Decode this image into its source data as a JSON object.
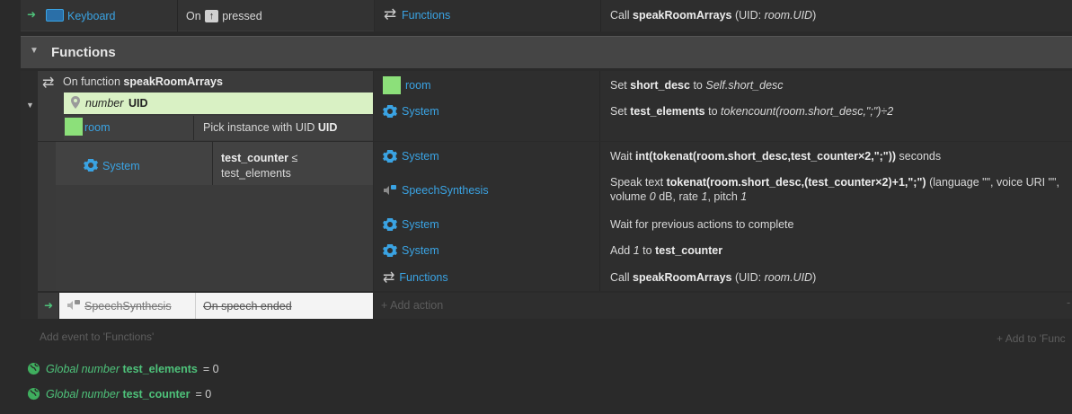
{
  "top_event": {
    "object": "Keyboard",
    "condition_prefix": "On",
    "key": "↑",
    "condition_suffix": "pressed",
    "action_object": "Functions",
    "action_prefix": "Call",
    "action_name": "speakRoomArrays",
    "action_suffix_open": " (UID: ",
    "action_param": "room.UID",
    "action_suffix_close": ")"
  },
  "group": {
    "title": "Functions"
  },
  "function_event": {
    "prefix": "On function",
    "name": "speakRoomArrays",
    "param_type": "number",
    "param_name": "UID",
    "pick_object": "room",
    "pick_text": "Pick instance with UID",
    "pick_param": "UID",
    "actions": [
      {
        "object": "room",
        "prefix": "Set",
        "target": "short_desc",
        "mid": "to",
        "value": "Self.short_desc"
      },
      {
        "object": "System",
        "prefix": "Set",
        "target": "test_elements",
        "mid": "to",
        "value": "tokencount(room.short_desc,\";\")÷2"
      }
    ]
  },
  "loop_event": {
    "object": "System",
    "condition_var": "test_counter",
    "condition_op": "≤",
    "condition_value": "test_elements",
    "actions": [
      {
        "object": "System",
        "prefix": "Wait",
        "expr": "int(tokenat(room.short_desc,test_counter×2,\";\"))",
        "suffix": "seconds"
      },
      {
        "object": "SpeechSynthesis",
        "prefix": "Speak text",
        "expr": "tokenat(room.short_desc,(test_counter×2)+1,\";\")",
        "suffix": "(language \"\", voice URI \"\",",
        "line2_a": "volume",
        "line2_vol": "0",
        "line2_b": "dB, rate",
        "line2_rate": "1",
        "line2_c": ", pitch",
        "line2_pitch": "1"
      },
      {
        "object": "System",
        "text": "Wait for previous actions to complete"
      },
      {
        "object": "System",
        "prefix": "Add",
        "amount": "1",
        "mid": "to",
        "target": "test_counter"
      },
      {
        "object": "Functions",
        "prefix": "Call",
        "name": "speakRoomArrays",
        "open": " (UID: ",
        "param": "room.UID",
        "close": ")"
      }
    ]
  },
  "speech_event": {
    "object": "SpeechSynthesis",
    "condition": "On speech ended",
    "add_action": "Add action"
  },
  "add_event_label": "Add event to 'Functions'",
  "add_to_label": "Add to 'Func",
  "globals": [
    {
      "prefix": "Global number",
      "name": "test_elements",
      "eq": "= 0"
    },
    {
      "prefix": "Global number",
      "name": "test_counter",
      "eq": "= 0"
    }
  ],
  "colors": {
    "accent": "#3aa3e3",
    "swatch": "#8ce07a",
    "green": "#4ec27a",
    "param_bg": "#d9f1c4"
  }
}
